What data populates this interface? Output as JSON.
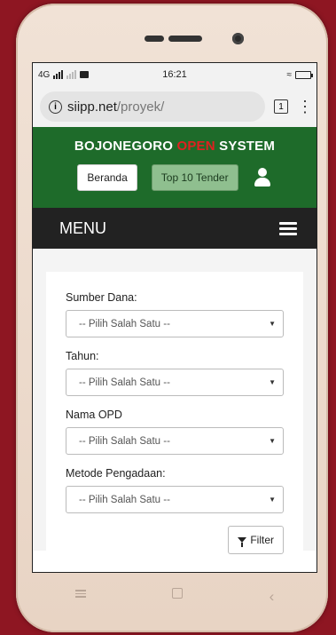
{
  "status_bar": {
    "network": "4G",
    "time": "16:21"
  },
  "browser": {
    "url_host": "siipp.net",
    "url_path": "/proyek/",
    "tab_count": "1",
    "info_icon": "i"
  },
  "header": {
    "brand_part1": "BOJONEGORO",
    "brand_part2": "OPEN",
    "brand_part3": "SYSTEM",
    "buttons": {
      "beranda": "Beranda",
      "top10": "Top 10 Tender"
    }
  },
  "menu": {
    "title": "MENU"
  },
  "form": {
    "fields": [
      {
        "label": "Sumber Dana:",
        "value": "-- Pilih Salah Satu --"
      },
      {
        "label": "Tahun:",
        "value": "-- Pilih Salah Satu --"
      },
      {
        "label": "Nama OPD",
        "value": "-- Pilih Salah Satu --"
      },
      {
        "label": "Metode Pengadaan:",
        "value": "-- Pilih Salah Satu --"
      }
    ],
    "filter_label": "Filter"
  },
  "colors": {
    "header_green": "#1e6b2a",
    "menu_dark": "#222222",
    "brand_red": "#e02020"
  }
}
